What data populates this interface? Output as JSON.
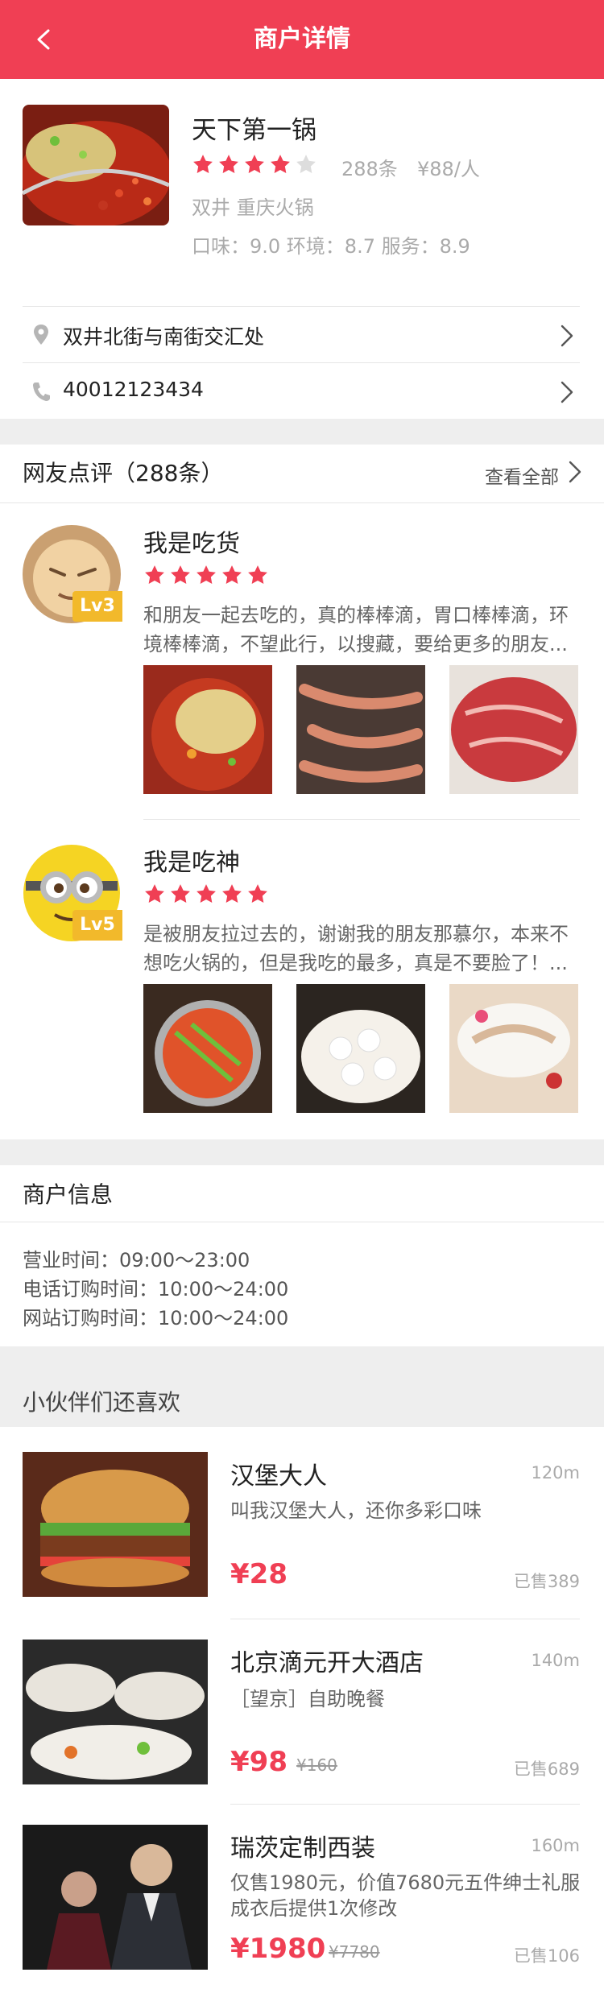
{
  "header": {
    "title": "商户详情",
    "back_icon": "chevron-left-icon"
  },
  "shop": {
    "name": "天下第一锅",
    "rating": 4,
    "rating_max": 5,
    "review_count": "288条",
    "price": "¥88/人",
    "category": "双井 重庆火锅",
    "scores": "口味：9.0 环境：8.7 服务：8.9",
    "address": "双井北街与南街交汇处",
    "phone": "40012123434"
  },
  "reviews": {
    "title": "网友点评（288条）",
    "see_all": "查看全部",
    "items": [
      {
        "name": "我是吃货",
        "level": "Lv3",
        "stars": 5,
        "text": "和朋友一起去吃的，真的棒棒滴，胃口棒棒滴，环境棒棒滴，不望此行，以搜藏，要给更多的朋友..."
      },
      {
        "name": "我是吃神",
        "level": "Lv5",
        "stars": 5,
        "text": "是被朋友拉过去的，谢谢我的朋友那慕尔，本来不想吃火锅的，但是我吃的最多，真是不要脸了！..."
      }
    ]
  },
  "merchant_info": {
    "title": "商户信息",
    "hours": "营业时间：09:00～23:00",
    "phone_hours": "电话订购时间：10:00～24:00",
    "web_hours": "网站订购时间：10:00～24:00"
  },
  "recommend": {
    "title": "小伙伴们还喜欢",
    "items": [
      {
        "name": "汉堡大人",
        "distance": "120m",
        "desc": "叫我汉堡大人，还你多彩口味",
        "price": "¥28",
        "old_price": "",
        "sold": "已售389"
      },
      {
        "name": "北京滴元开大酒店",
        "distance": "140m",
        "desc": "［望京］自助晚餐",
        "price": "¥98",
        "old_price": "¥160",
        "sold": "已售689"
      },
      {
        "name": "瑞茨定制西装",
        "distance": "160m",
        "desc": "仅售1980元，价值7680元五件绅士礼服成衣后提供1次修改",
        "price": "¥1980",
        "old_price": "¥7780",
        "sold": "已售106"
      }
    ]
  },
  "colors": {
    "brand": "#f03f54",
    "star_empty": "#dddddd",
    "level_badge": "#f2b92b"
  }
}
